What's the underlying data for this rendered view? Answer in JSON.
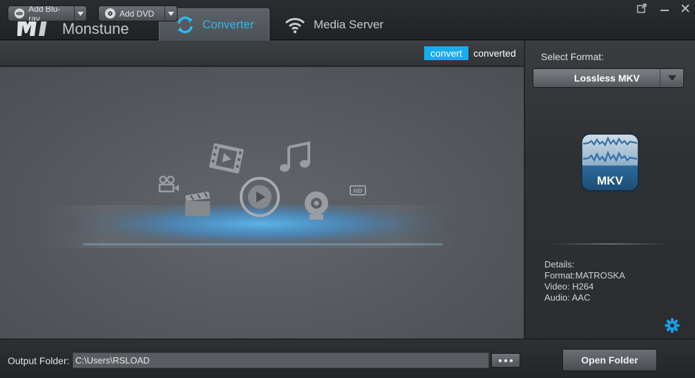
{
  "app": {
    "name": "Monstune",
    "logo_text": "MT"
  },
  "tabs": [
    {
      "label": "Converter",
      "active": true,
      "icon": "refresh-icon"
    },
    {
      "label": "Media Server",
      "active": false,
      "icon": "wifi-icon"
    }
  ],
  "window_controls": [
    "popout-icon",
    "minimize-icon",
    "close-icon"
  ],
  "toolbar": {
    "add_bluray_label": "Add Blu-ray",
    "add_dvd_label": "Add DVD",
    "convert_label": "convert",
    "converted_label": "converted",
    "active_segment": "convert"
  },
  "drop_area": {
    "icons": [
      "film-icon",
      "music-note-icon",
      "camcorder-icon",
      "clapperboard-icon",
      "play-circle-icon",
      "webcam-icon",
      "hd-icon"
    ]
  },
  "format": {
    "select_label": "Select Format:",
    "selected": "Lossless MKV",
    "badge": "MKV",
    "details_title": "Details:",
    "details": {
      "format": "Format:MATROSKA",
      "video": "Video: H264",
      "audio": "Audio: AAC"
    }
  },
  "output": {
    "label": "Output Folder:",
    "path": "C:\\Users\\RSLOAD",
    "browse_label": "...",
    "open_folder_label": "Open Folder"
  },
  "colors": {
    "accent": "#14aef0",
    "active_tab_text": "#2db8f0",
    "background": "#2a2c2f"
  }
}
